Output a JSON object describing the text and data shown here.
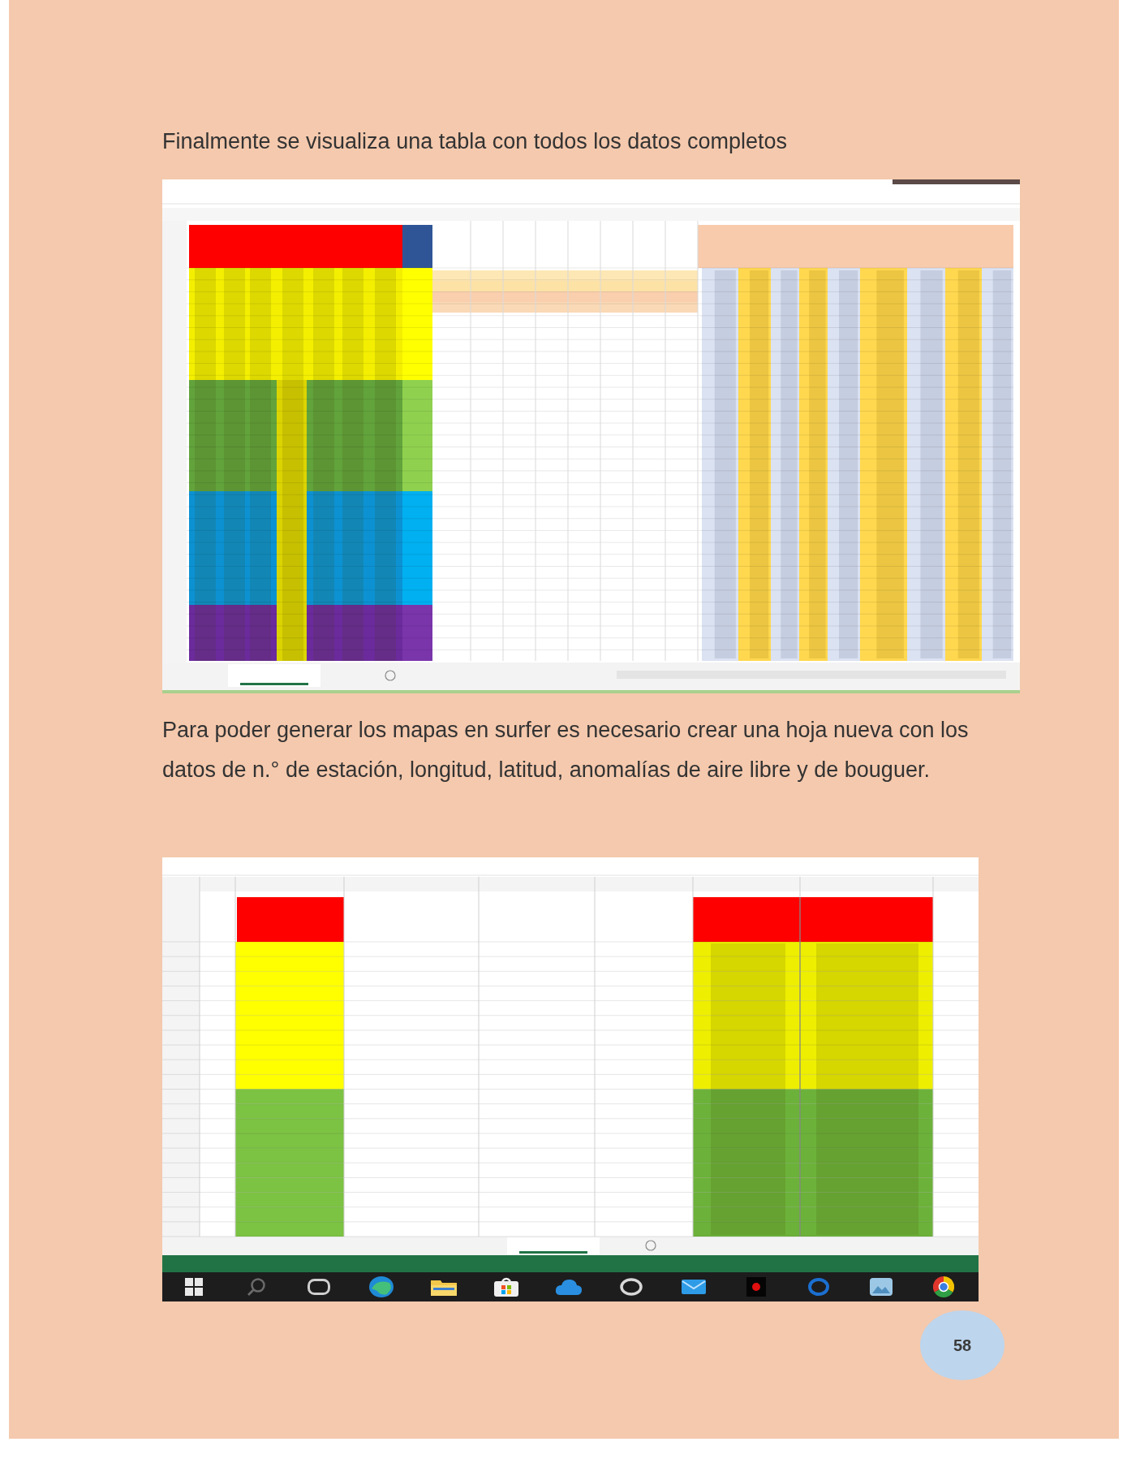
{
  "page": {
    "intro_text": "Finalmente se visualiza una tabla con todos los datos completos",
    "instructions_text": "Para poder generar los mapas en surfer es necesario crear una hoja nueva con los datos de n.° de estación, longitud, latitud, anomalías de aire libre y de bouguer.",
    "page_number": "58"
  }
}
